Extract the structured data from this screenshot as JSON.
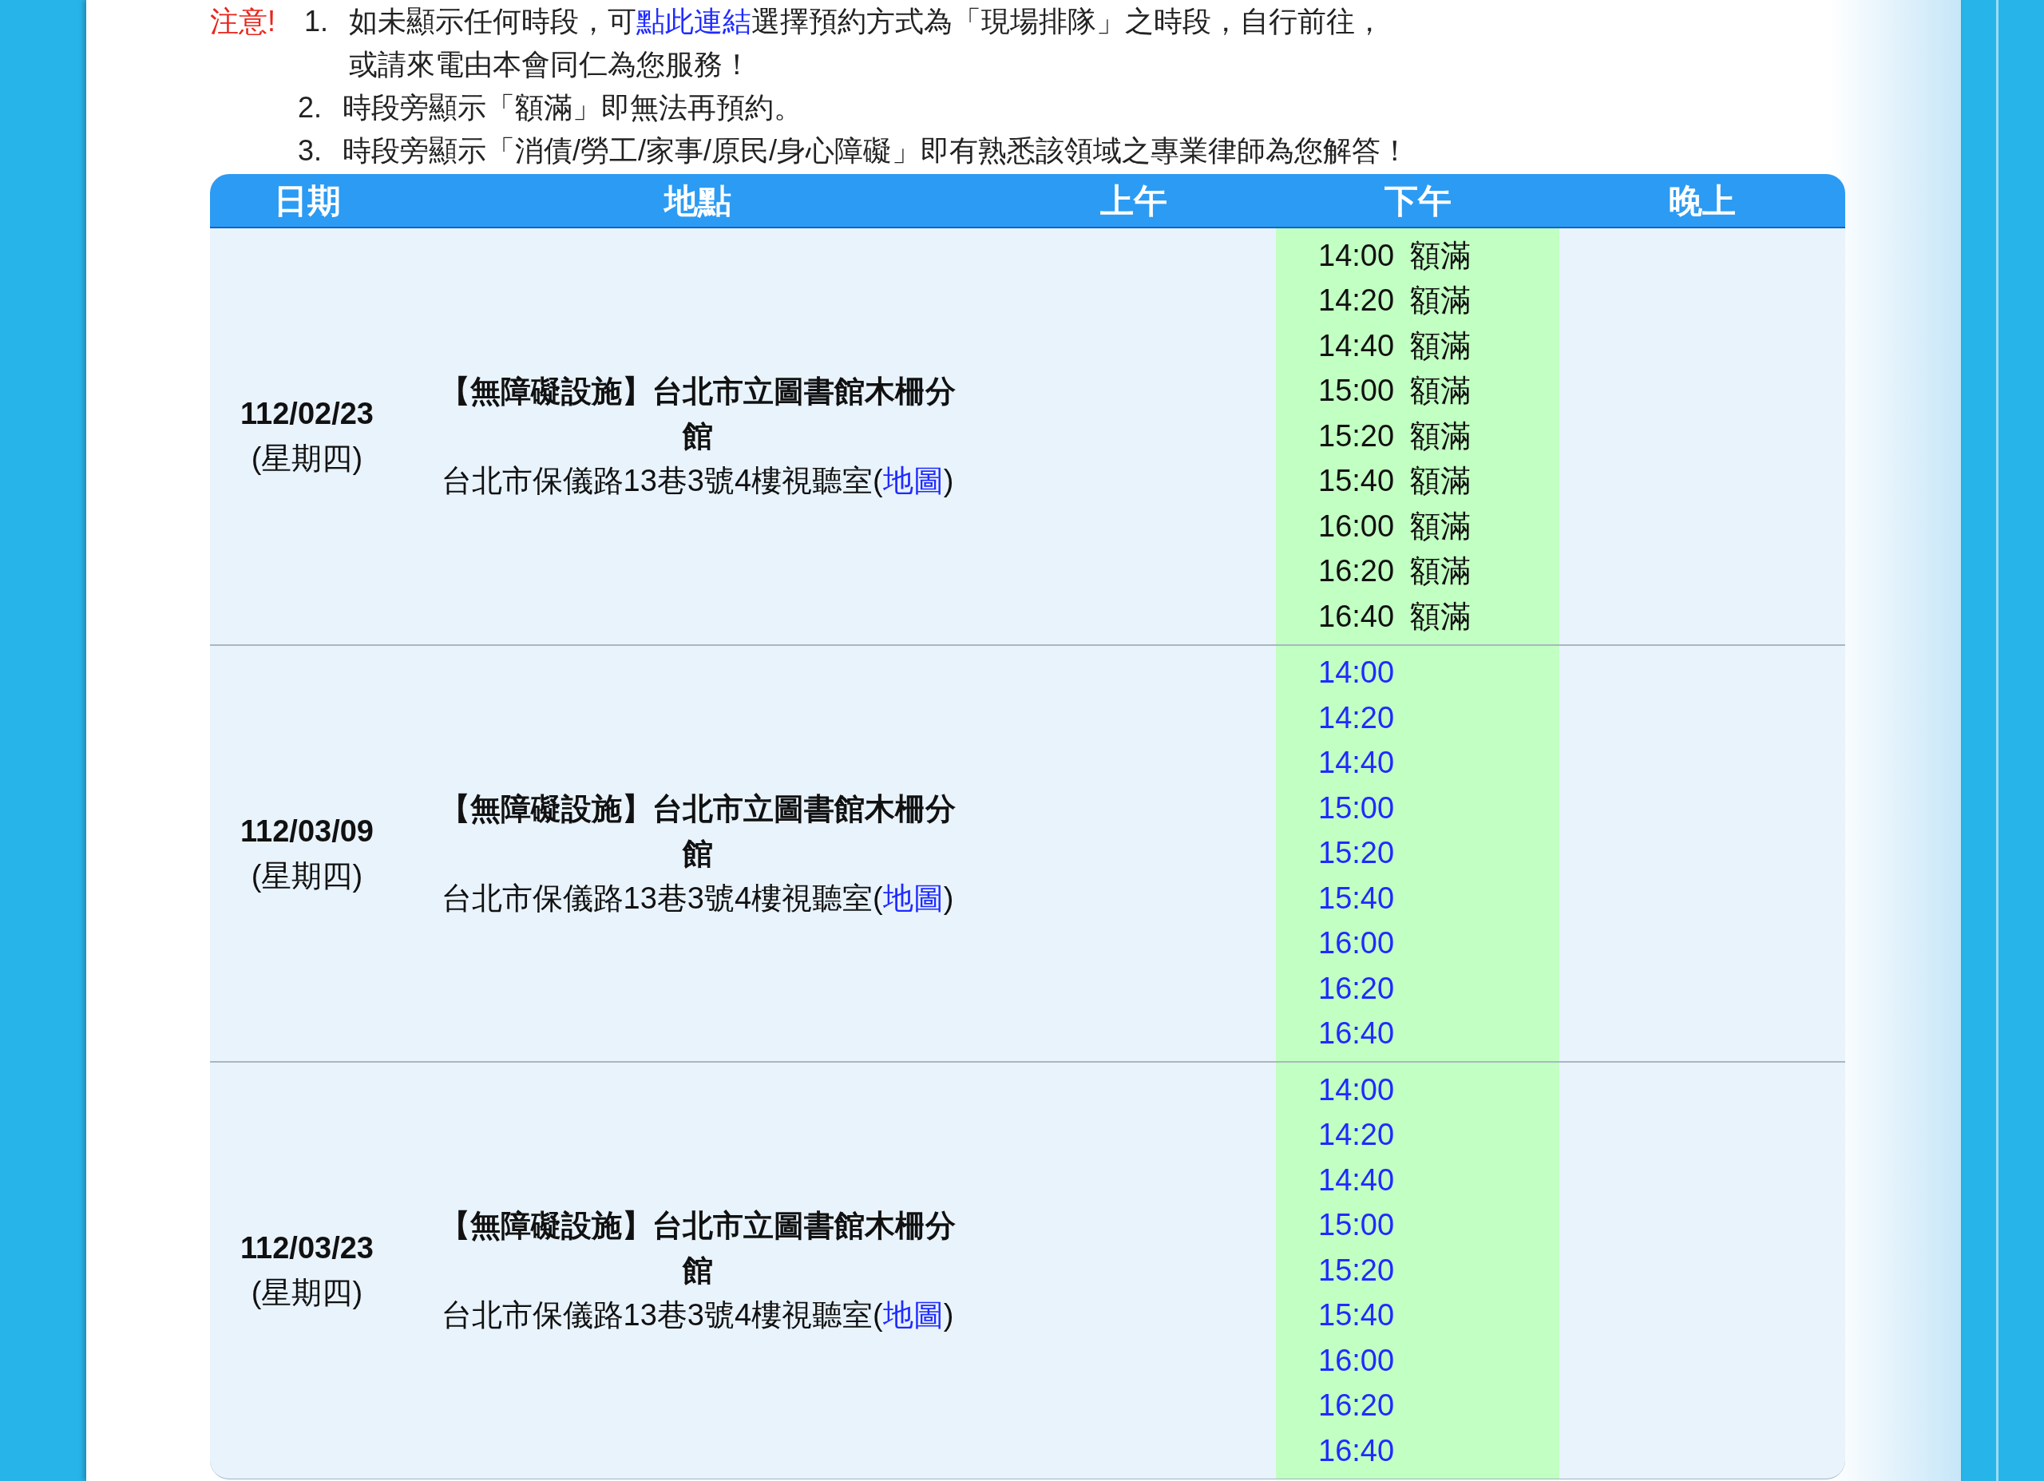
{
  "notice": {
    "label": "注意!",
    "items": [
      {
        "number": "1.",
        "text_before": "如未顯示任何時段，可",
        "link": "點此連結",
        "text_after": "選擇預約方式為「現場排隊」之時段，自行前往，",
        "continuation": "或請來電由本會同仁為您服務！"
      },
      {
        "number": "2.",
        "text_before": "時段旁顯示「額滿」即無法再預約。"
      },
      {
        "number": "3.",
        "text_before": "時段旁顯示「消債/勞工/家事/原民/身心障礙」即有熟悉該領域之專業律師為您解答！"
      }
    ]
  },
  "table": {
    "columns": [
      "日期",
      "地點",
      "上午",
      "下午",
      "晚上"
    ],
    "rows": [
      {
        "date": "112/02/23",
        "weekday": "(星期四)",
        "place": "【無障礙設施】台北市立圖書館木柵分館",
        "address_before": "台北市保儀路13巷3號4樓視聽室(",
        "map_link": "地圖",
        "address_after": ")",
        "afternoon_slots": [
          {
            "time": "14:00",
            "full": true,
            "status": "額滿"
          },
          {
            "time": "14:20",
            "full": true,
            "status": "額滿"
          },
          {
            "time": "14:40",
            "full": true,
            "status": "額滿"
          },
          {
            "time": "15:00",
            "full": true,
            "status": "額滿"
          },
          {
            "time": "15:20",
            "full": true,
            "status": "額滿"
          },
          {
            "time": "15:40",
            "full": true,
            "status": "額滿"
          },
          {
            "time": "16:00",
            "full": true,
            "status": "額滿"
          },
          {
            "time": "16:20",
            "full": true,
            "status": "額滿"
          },
          {
            "time": "16:40",
            "full": true,
            "status": "額滿"
          }
        ]
      },
      {
        "date": "112/03/09",
        "weekday": "(星期四)",
        "place": "【無障礙設施】台北市立圖書館木柵分館",
        "address_before": "台北市保儀路13巷3號4樓視聽室(",
        "map_link": "地圖",
        "address_after": ")",
        "afternoon_slots": [
          {
            "time": "14:00",
            "full": false
          },
          {
            "time": "14:20",
            "full": false
          },
          {
            "time": "14:40",
            "full": false
          },
          {
            "time": "15:00",
            "full": false
          },
          {
            "time": "15:20",
            "full": false
          },
          {
            "time": "15:40",
            "full": false
          },
          {
            "time": "16:00",
            "full": false
          },
          {
            "time": "16:20",
            "full": false
          },
          {
            "time": "16:40",
            "full": false
          }
        ]
      },
      {
        "date": "112/03/23",
        "weekday": "(星期四)",
        "place": "【無障礙設施】台北市立圖書館木柵分館",
        "address_before": "台北市保儀路13巷3號4樓視聽室(",
        "map_link": "地圖",
        "address_after": ")",
        "afternoon_slots": [
          {
            "time": "14:00",
            "full": false
          },
          {
            "time": "14:20",
            "full": false
          },
          {
            "time": "14:40",
            "full": false
          },
          {
            "time": "15:00",
            "full": false
          },
          {
            "time": "15:20",
            "full": false
          },
          {
            "time": "15:40",
            "full": false
          },
          {
            "time": "16:00",
            "full": false
          },
          {
            "time": "16:20",
            "full": false
          },
          {
            "time": "16:40",
            "full": false
          }
        ]
      }
    ]
  }
}
